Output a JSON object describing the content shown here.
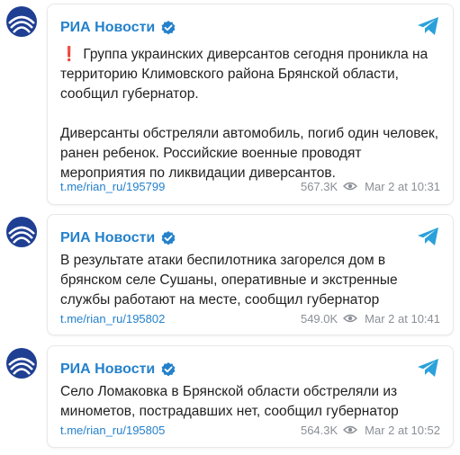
{
  "colors": {
    "accent": "#2481cc",
    "alert": "#e0231b",
    "meta": "#8a8f96"
  },
  "posts": [
    {
      "channel": "РИА Новости",
      "alert_glyph": "❗",
      "paragraphs": [
        "Группа украинских диверсантов сегодня проникла на территорию Климовского района Брянской области, сообщил губернатор.",
        "Диверсанты обстреляли автомобиль, погиб один человек, ранен ребенок. Российские военные проводят мероприятия по ликвидации диверсантов."
      ],
      "link": "t.me/rian_ru/195799",
      "views": "567.3K",
      "date": "Mar 2 at 10:31"
    },
    {
      "channel": "РИА Новости",
      "paragraphs": [
        "В результате атаки беспилотника загорелся дом в брянском селе Сушаны, оперативные и экстренные службы работают на месте, сообщил губернатор"
      ],
      "link": "t.me/rian_ru/195802",
      "views": "549.0K",
      "date": "Mar 2 at 10:41"
    },
    {
      "channel": "РИА Новости",
      "paragraphs": [
        "Село Ломаковка в Брянской области обстреляли из минометов, пострадавших нет, сообщил губернатор"
      ],
      "link": "t.me/rian_ru/195805",
      "views": "564.3K",
      "date": "Mar 2 at 10:52"
    }
  ]
}
